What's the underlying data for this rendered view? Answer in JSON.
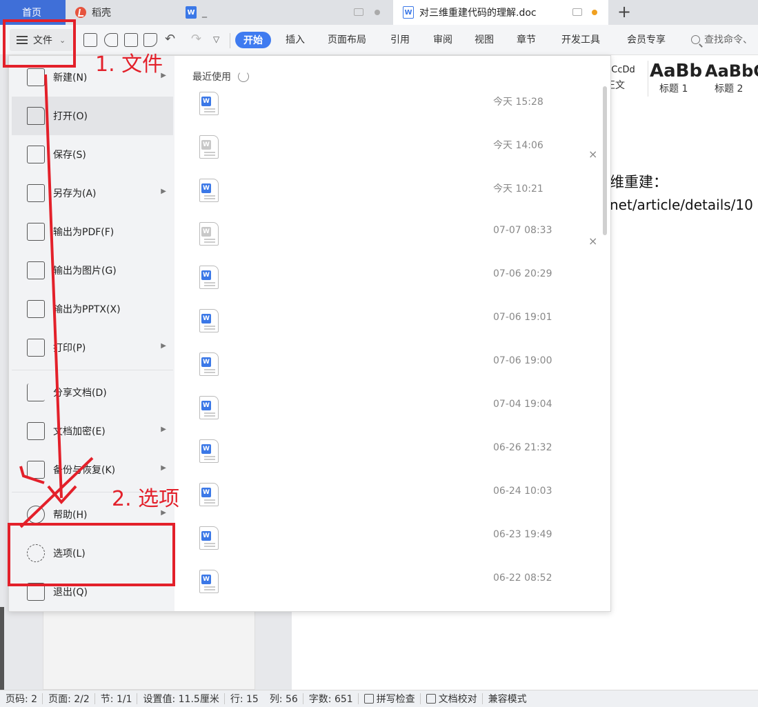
{
  "tabs": {
    "home": "首页",
    "daoke": "稻壳",
    "doc1_label": "_",
    "active_doc": "对三维重建代码的理解.doc",
    "new_tab": "+"
  },
  "toolbar": {
    "file_label": "文件",
    "ribbon_tabs": [
      "开始",
      "插入",
      "页面布局",
      "引用",
      "审阅",
      "视图",
      "章节",
      "开发工具",
      "会员专享"
    ],
    "search": "查找命令、"
  },
  "styles": {
    "normal_sample": "bCcDd",
    "normal_name": "正文",
    "h1_sample": "AaBb",
    "h1_name": "标题 1",
    "h2_sample": "AaBbC",
    "h2_name": "标题 2"
  },
  "document": {
    "line1": "维重建：",
    "line2": "net/article/details/10"
  },
  "file_menu": {
    "items": [
      {
        "label": "新建(N)",
        "icon": "new-doc-icon",
        "submenu": true
      },
      {
        "label": "打开(O)",
        "icon": "open-folder-icon",
        "submenu": false
      },
      {
        "label": "保存(S)",
        "icon": "save-icon",
        "submenu": false
      },
      {
        "label": "另存为(A)",
        "icon": "save-as-icon",
        "submenu": true
      },
      {
        "label": "输出为PDF(F)",
        "icon": "pdf-export-icon",
        "submenu": false
      },
      {
        "label": "输出为图片(G)",
        "icon": "image-export-icon",
        "submenu": false
      },
      {
        "label": "输出为PPTX(X)",
        "icon": "pptx-export-icon",
        "submenu": false
      },
      {
        "label": "打印(P)",
        "icon": "printer-icon",
        "submenu": true
      },
      {
        "label": "分享文档(D)",
        "icon": "share-icon",
        "submenu": false
      },
      {
        "label": "文档加密(E)",
        "icon": "lock-doc-icon",
        "submenu": true
      },
      {
        "label": "备份与恢复(K)",
        "icon": "backup-icon",
        "submenu": true
      },
      {
        "label": "帮助(H)",
        "icon": "help-icon",
        "submenu": true
      },
      {
        "label": "选项(L)",
        "icon": "gear-icon",
        "submenu": false
      },
      {
        "label": "退出(Q)",
        "icon": "exit-icon",
        "submenu": false
      }
    ],
    "recent_title": "最近使用",
    "recent": [
      {
        "time": "今天 15:28",
        "faded": false,
        "closable": false
      },
      {
        "time": "今天 14:06",
        "faded": true,
        "closable": true
      },
      {
        "time": "今天 10:21",
        "faded": false,
        "closable": false
      },
      {
        "time": "07-07 08:33",
        "faded": true,
        "closable": true
      },
      {
        "time": "07-06 20:29",
        "faded": false,
        "closable": false
      },
      {
        "time": "07-06 19:01",
        "faded": false,
        "closable": false
      },
      {
        "time": "07-06 19:00",
        "faded": false,
        "closable": false
      },
      {
        "time": "07-04 19:04",
        "faded": false,
        "closable": false
      },
      {
        "time": "06-26 21:32",
        "faded": false,
        "closable": false
      },
      {
        "time": "06-24 10:03",
        "faded": false,
        "closable": false
      },
      {
        "time": "06-23 19:49",
        "faded": false,
        "closable": false
      },
      {
        "time": "06-22 08:52",
        "faded": false,
        "closable": false
      }
    ],
    "close_glyph": "×"
  },
  "annotations": {
    "step1": "1. 文件",
    "step2": "2. 选项"
  },
  "statusbar": {
    "page_code": "页码: 2",
    "page": "页面: 2/2",
    "section": "节: 1/1",
    "setting": "设置值: 11.5厘米",
    "row": "行: 15",
    "col": "列: 56",
    "words": "字数: 651",
    "spell": "拼写检查",
    "proof": "文档校对",
    "compat": "兼容模式"
  },
  "colors": {
    "accent": "#3f7bf0",
    "annotation": "#e3202a",
    "home_tab": "#3f6fd8"
  }
}
